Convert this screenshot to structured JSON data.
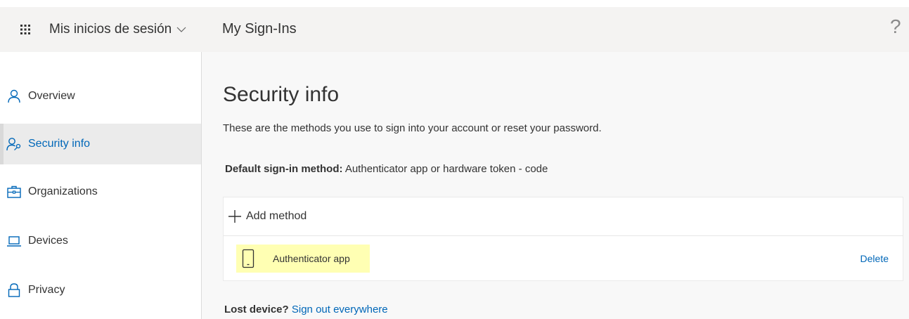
{
  "header": {
    "app_name": "Mis inicios de sesión",
    "page_title": "My Sign-Ins",
    "help_glyph": "?"
  },
  "sidebar": {
    "items": [
      {
        "label": "Overview",
        "icon": "person-icon",
        "active": false
      },
      {
        "label": "Security info",
        "icon": "person-key-icon",
        "active": true
      },
      {
        "label": "Organizations",
        "icon": "briefcase-icon",
        "active": false
      },
      {
        "label": "Devices",
        "icon": "laptop-icon",
        "active": false
      },
      {
        "label": "Privacy",
        "icon": "lock-icon",
        "active": false
      }
    ]
  },
  "main": {
    "title": "Security info",
    "description": "These are the methods you use to sign into your account or reset your password.",
    "default_method_label": "Default sign-in method:",
    "default_method_value": " Authenticator app or hardware token - code",
    "add_method_label": "Add method",
    "methods": [
      {
        "name": "Authenticator app",
        "icon": "phone-icon",
        "action": "Delete"
      }
    ],
    "lost_device_label": "Lost device?",
    "sign_out_link": "Sign out everywhere"
  },
  "colors": {
    "accent": "#0067b8",
    "header_bg": "#f4f3f2",
    "main_bg": "#f8f8f8",
    "highlight": "#ffffb3"
  }
}
